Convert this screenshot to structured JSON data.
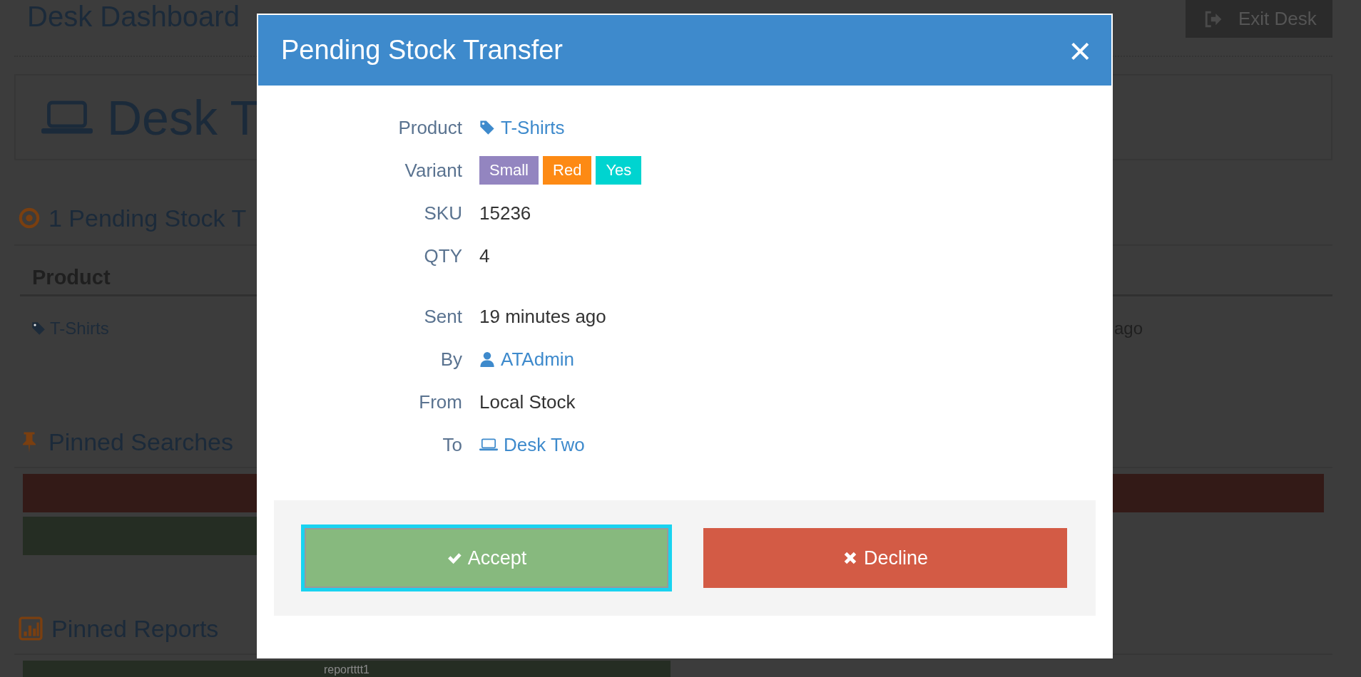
{
  "background": {
    "title": "Desk Dashboard",
    "exit_button": "Exit Desk",
    "desk_name": "Desk T",
    "pending_heading": "1 Pending Stock T",
    "table": {
      "columns": [
        "Product"
      ],
      "rows": [
        {
          "product": "T-Shirts",
          "column_2": "ago"
        }
      ]
    },
    "pinned_searches": {
      "heading": "Pinned Searches",
      "items": [
        {
          "color": "#331a17"
        },
        {
          "color": "#252d23"
        }
      ]
    },
    "pinned_reports": {
      "heading": "Pinned Reports",
      "items": [
        {
          "label": "reportttt1"
        }
      ]
    }
  },
  "modal": {
    "title": "Pending Stock Transfer",
    "close": "×",
    "item_fields": [
      {
        "label": "Product",
        "kind": "product",
        "value": "T-Shirts"
      },
      {
        "label": "Variant",
        "kind": "tags",
        "tags": [
          {
            "text": "Small",
            "color": "#9385c0"
          },
          {
            "text": "Red",
            "color": "#fd8a14"
          },
          {
            "text": "Yes",
            "color": "#00d4d0"
          }
        ]
      },
      {
        "label": "SKU",
        "kind": "text",
        "value": "15236"
      },
      {
        "label": "QTY",
        "kind": "text",
        "value": "4"
      }
    ],
    "transfer_fields": [
      {
        "label": "Sent",
        "kind": "text",
        "value": "19 minutes ago"
      },
      {
        "label": "By",
        "kind": "user",
        "value": "ATAdmin"
      },
      {
        "label": "From",
        "kind": "text",
        "value": "Local Stock"
      },
      {
        "label": "To",
        "kind": "desk",
        "value": "Desk Two"
      }
    ],
    "buttons": [
      {
        "label": "Accept",
        "kind": "accept",
        "focused": true
      },
      {
        "label": "Decline",
        "kind": "decline",
        "focused": false
      }
    ]
  }
}
